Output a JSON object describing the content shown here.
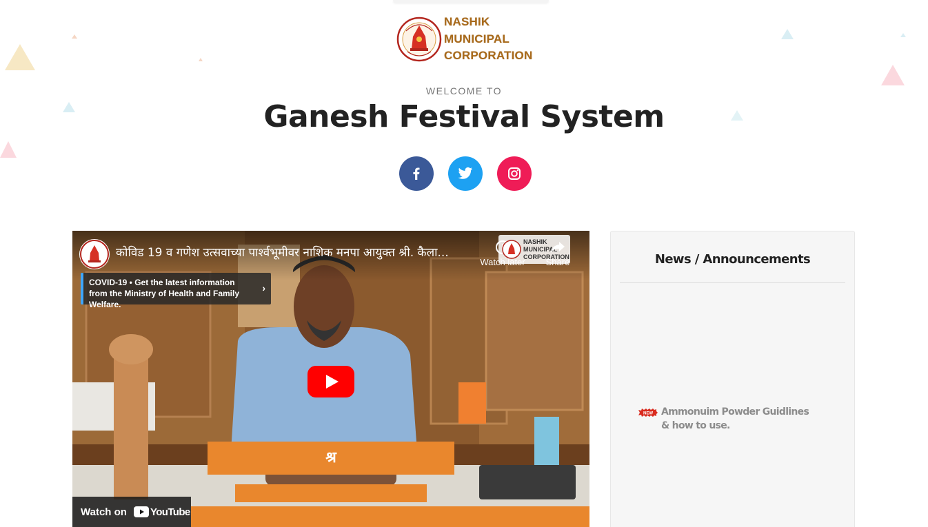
{
  "header": {
    "logo_lines": [
      "NASHIK",
      "MUNICIPAL",
      "CORPORATION"
    ],
    "welcome": "WELCOME TO",
    "title": "Ganesh Festival System"
  },
  "social": [
    {
      "name": "facebook",
      "icon": "facebook-icon",
      "color": "#3b5998"
    },
    {
      "name": "twitter",
      "icon": "twitter-icon",
      "color": "#1da1f2"
    },
    {
      "name": "instagram",
      "icon": "instagram-icon",
      "color": "#ef1c57"
    }
  ],
  "video": {
    "title": "कोविड 19 व गणेश उत्सवाच्या पार्श्वभूमीवर नाशिक मनपा आयुक्त श्री. कैला...",
    "watch_later": "Watch later",
    "share": "Share",
    "covid_notice": "COVID-19 • Get the latest information from the Ministry of Health and Family Welfare.",
    "watch_on": "Watch on",
    "youtube": "YouTube",
    "banner_text": "श्र",
    "watermark_lines": [
      "NASHIK",
      "MUNICIPAL",
      "CORPORATION"
    ]
  },
  "news": {
    "title": "News / Announcements",
    "badge": "NEW",
    "items": [
      {
        "text": "Ammonuim Powder Guidlines & how to use."
      }
    ]
  },
  "colors": {
    "title": "#222222",
    "accent_orange": "#e9872d",
    "logo_brown": "#a86a1b",
    "youtube_red": "#ff0000"
  }
}
